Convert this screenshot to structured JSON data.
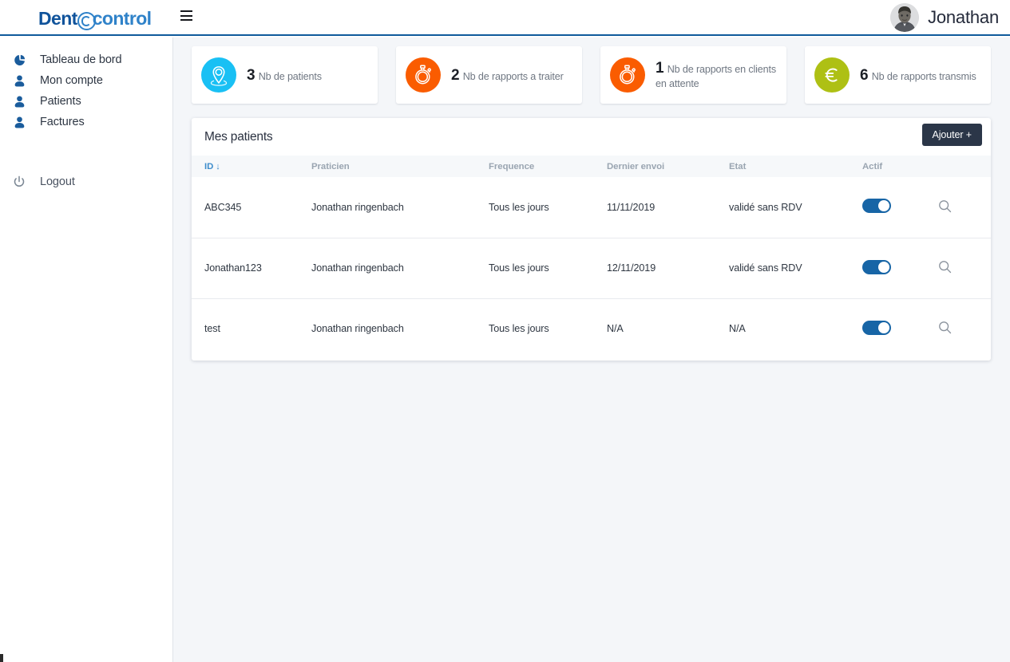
{
  "header": {
    "brand_part1": "Dent",
    "brand_at": "@",
    "brand_part2": "control",
    "menu_icon": "hamburger-menu-icon",
    "user_name": "Jonathan",
    "avatar_icon": "user-avatar-photo"
  },
  "sidebar": {
    "items": [
      {
        "label": "Tableau de bord",
        "icon": "pie-chart-icon"
      },
      {
        "label": "Mon compte",
        "icon": "user-icon"
      },
      {
        "label": "Patients",
        "icon": "user-icon"
      },
      {
        "label": "Factures",
        "icon": "user-icon"
      }
    ],
    "logout": {
      "label": "Logout",
      "icon": "power-icon"
    }
  },
  "stats": [
    {
      "value": "3",
      "label": "Nb de patients",
      "icon": "map-pin-icon",
      "color": "#19c0f4"
    },
    {
      "value": "2",
      "label": "Nb de rapports a traiter",
      "icon": "stopwatch-icon",
      "color": "#fa5c00"
    },
    {
      "value": "1",
      "label": "Nb de rapports en clients en attente",
      "icon": "stopwatch-icon",
      "color": "#fa5c00"
    },
    {
      "value": "6",
      "label": "Nb de rapports transmis",
      "icon": "euro-icon",
      "color": "#aec014"
    }
  ],
  "panel": {
    "title": "Mes patients",
    "add_label": "Ajouter +",
    "columns": [
      {
        "key": "id",
        "label": "ID",
        "sort": "↓",
        "active": true
      },
      {
        "key": "praticien",
        "label": "Praticien",
        "active": false
      },
      {
        "key": "frequence",
        "label": "Frequence",
        "active": false
      },
      {
        "key": "dernier_envoi",
        "label": "Dernier envoi",
        "active": false
      },
      {
        "key": "etat",
        "label": "Etat",
        "active": false
      },
      {
        "key": "actif",
        "label": "Actif",
        "active": false
      },
      {
        "key": "actions",
        "label": "",
        "active": false
      }
    ],
    "rows": [
      {
        "id": "ABC345",
        "praticien": "Jonathan ringenbach",
        "frequence": "Tous les jours",
        "dernier_envoi": "11/11/2019",
        "etat": "validé sans RDV",
        "actif": true,
        "action_icon": "search-icon"
      },
      {
        "id": "Jonathan123",
        "praticien": "Jonathan ringenbach",
        "frequence": "Tous les jours",
        "dernier_envoi": "12/11/2019",
        "etat": "validé sans RDV",
        "actif": true,
        "action_icon": "search-icon"
      },
      {
        "id": "test",
        "praticien": "Jonathan ringenbach",
        "frequence": "Tous les jours",
        "dernier_envoi": "N/A",
        "etat": "N/A",
        "actif": true,
        "action_icon": "search-icon"
      }
    ]
  },
  "theme": {
    "brand_blue": "#10539b",
    "accent_blue": "#2f82c9",
    "toggle_on": "#1765a6",
    "dark_button": "#2b3648",
    "content_bg": "#f4f6f9"
  }
}
